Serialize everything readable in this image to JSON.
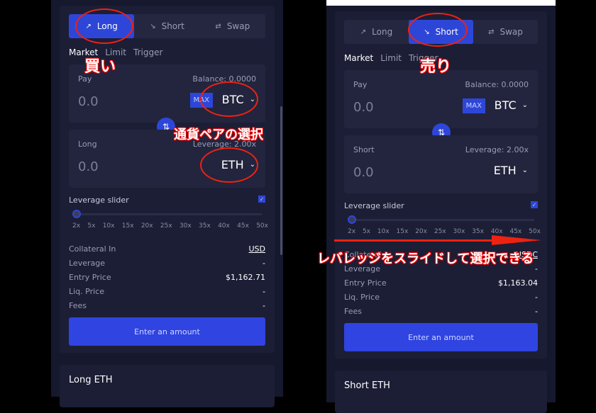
{
  "left": {
    "tabs": [
      {
        "label": "Long",
        "icon": "trend-up-icon"
      },
      {
        "label": "Short",
        "icon": "trend-down-icon"
      },
      {
        "label": "Swap",
        "icon": "swap-icon"
      }
    ],
    "active_tab": 0,
    "order_types": [
      "Market",
      "Limit",
      "Trigger"
    ],
    "pay": {
      "label": "Pay",
      "balance": "Balance: 0.0000",
      "amount": "0.0",
      "max": "MAX",
      "token": "BTC"
    },
    "receive": {
      "label": "Long",
      "leverage": "Leverage: 2.00x",
      "amount": "0.0",
      "token": "ETH"
    },
    "slider": {
      "label": "Leverage slider",
      "checked": true,
      "value": "2x",
      "ticks": [
        "2x",
        "5x",
        "10x",
        "15x",
        "20x",
        "25x",
        "30x",
        "35x",
        "40x",
        "45x",
        "50x"
      ]
    },
    "rows": [
      {
        "k": "Collateral In",
        "v": "USD"
      },
      {
        "k": "Leverage",
        "v": "-"
      },
      {
        "k": "Entry Price",
        "v": "$1,162.71"
      },
      {
        "k": "Liq. Price",
        "v": "-"
      },
      {
        "k": "Fees",
        "v": "-"
      }
    ],
    "button": "Enter an amount",
    "section": "Long ETH"
  },
  "right": {
    "tabs": [
      {
        "label": "Long",
        "icon": "trend-up-icon"
      },
      {
        "label": "Short",
        "icon": "trend-down-icon"
      },
      {
        "label": "Swap",
        "icon": "swap-icon"
      }
    ],
    "active_tab": 1,
    "order_types": [
      "Market",
      "Limit",
      "Trigger"
    ],
    "pay": {
      "label": "Pay",
      "balance": "Balance: 0.0000",
      "amount": "0.0",
      "max": "MAX",
      "token": "BTC"
    },
    "receive": {
      "label": "Short",
      "leverage": "Leverage: 2.00x",
      "amount": "0.0",
      "token": "ETH"
    },
    "slider": {
      "label": "Leverage slider",
      "checked": true,
      "value": "2x",
      "ticks": [
        "2x",
        "5x",
        "10x",
        "15x",
        "20x",
        "25x",
        "30x",
        "35x",
        "40x",
        "45x",
        "50x"
      ]
    },
    "rows": [
      {
        "k": "Collateral In",
        "v": "USDC"
      },
      {
        "k": "Leverage",
        "v": "-"
      },
      {
        "k": "Entry Price",
        "v": "$1,163.04"
      },
      {
        "k": "Liq. Price",
        "v": "-"
      },
      {
        "k": "Fees",
        "v": "-"
      }
    ],
    "button": "Enter an amount",
    "section": "Short ETH"
  },
  "annotations": {
    "buy": "買い",
    "sell": "売り",
    "pair": "通貨ペアの選択",
    "leverage": "レバレッジをスライドして選択できる"
  },
  "colors": {
    "accent": "#2e46d8",
    "annotation": "#e02020",
    "bg": "#16182e"
  }
}
